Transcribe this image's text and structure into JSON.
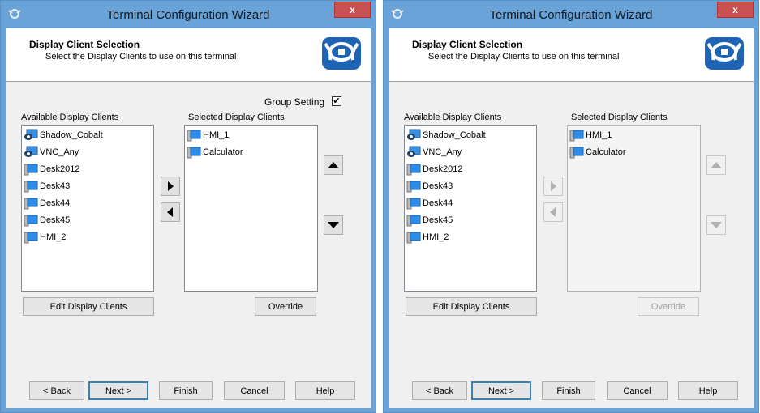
{
  "colors": {
    "titlebar": "#6aa3d8",
    "close_button": "#c75050",
    "client_bg": "#f0f0f0",
    "logo_bg": "#1f64b4",
    "disabled_text": "#a0a0a0"
  },
  "windows": [
    {
      "state": "enabled",
      "title": "Terminal Configuration Wizard",
      "close_label": "x",
      "header": {
        "title": "Display Client Selection",
        "subtitle": "Select the Display Clients to use on this terminal"
      },
      "group_setting": {
        "label": "Group Setting",
        "checked": true,
        "check_glyph": "✔"
      },
      "available": {
        "label": "Available Display Clients",
        "items": [
          {
            "label": "Shadow_Cobalt",
            "icon": "shadow-client-icon"
          },
          {
            "label": "VNC_Any",
            "icon": "vnc-client-icon"
          },
          {
            "label": "Desk2012",
            "icon": "desktop-client-icon"
          },
          {
            "label": "Desk43",
            "icon": "desktop-client-icon"
          },
          {
            "label": "Desk44",
            "icon": "desktop-client-icon"
          },
          {
            "label": "Desk45",
            "icon": "desktop-client-icon"
          },
          {
            "label": "HMI_2",
            "icon": "desktop-client-icon"
          }
        ]
      },
      "selected": {
        "label": "Selected Display Clients",
        "items": [
          {
            "label": "HMI_1",
            "icon": "desktop-client-icon"
          },
          {
            "label": "Calculator",
            "icon": "desktop-client-icon"
          }
        ]
      },
      "edit_label": "Edit Display Clients",
      "override_label": "Override",
      "nav": {
        "back": "< Back",
        "next": "Next >",
        "finish": "Finish",
        "cancel": "Cancel",
        "help": "Help"
      }
    },
    {
      "state": "disabled",
      "title": "Terminal Configuration Wizard",
      "close_label": "x",
      "header": {
        "title": "Display Client Selection",
        "subtitle": "Select the Display Clients to use on this terminal"
      },
      "available": {
        "label": "Available Display Clients",
        "items": [
          {
            "label": "Shadow_Cobalt",
            "icon": "shadow-client-icon"
          },
          {
            "label": "VNC_Any",
            "icon": "vnc-client-icon"
          },
          {
            "label": "Desk2012",
            "icon": "desktop-client-icon"
          },
          {
            "label": "Desk43",
            "icon": "desktop-client-icon"
          },
          {
            "label": "Desk44",
            "icon": "desktop-client-icon"
          },
          {
            "label": "Desk45",
            "icon": "desktop-client-icon"
          },
          {
            "label": "HMI_2",
            "icon": "desktop-client-icon"
          }
        ]
      },
      "selected": {
        "label": "Selected Display Clients",
        "items": [
          {
            "label": "HMI_1",
            "icon": "desktop-client-icon"
          },
          {
            "label": "Calculator",
            "icon": "desktop-client-icon"
          }
        ]
      },
      "edit_label": "Edit Display Clients",
      "override_label": "Override",
      "nav": {
        "back": "< Back",
        "next": "Next >",
        "finish": "Finish",
        "cancel": "Cancel",
        "help": "Help"
      }
    }
  ]
}
